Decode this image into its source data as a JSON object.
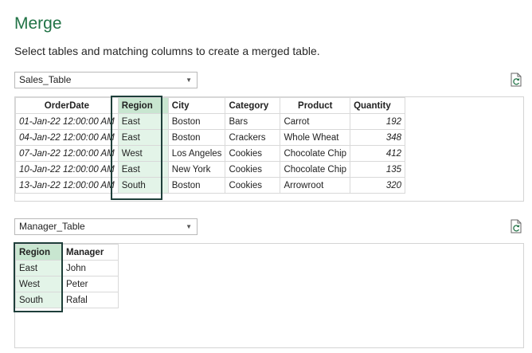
{
  "dialog": {
    "title": "Merge",
    "subtitle": "Select tables and matching columns to create a merged table."
  },
  "table1": {
    "selected": "Sales_Table",
    "columns": [
      "OrderDate",
      "Region",
      "City",
      "Category",
      "Product",
      "Quantity"
    ],
    "rows": [
      [
        "01-Jan-22 12:00:00 AM",
        "East",
        "Boston",
        "Bars",
        "Carrot",
        "192"
      ],
      [
        "04-Jan-22 12:00:00 AM",
        "East",
        "Boston",
        "Crackers",
        "Whole Wheat",
        "348"
      ],
      [
        "07-Jan-22 12:00:00 AM",
        "West",
        "Los Angeles",
        "Cookies",
        "Chocolate Chip",
        "412"
      ],
      [
        "10-Jan-22 12:00:00 AM",
        "East",
        "New York",
        "Cookies",
        "Chocolate Chip",
        "135"
      ],
      [
        "13-Jan-22 12:00:00 AM",
        "South",
        "Boston",
        "Cookies",
        "Arrowroot",
        "320"
      ]
    ],
    "selected_column": "Region"
  },
  "table2": {
    "selected": "Manager_Table",
    "columns": [
      "Region",
      "Manager"
    ],
    "rows": [
      [
        "East",
        "John"
      ],
      [
        "West",
        "Peter"
      ],
      [
        "South",
        "Rafal"
      ]
    ],
    "selected_column": "Region"
  },
  "icons": {
    "dropdown": "chevron-down-icon",
    "refresh": "refresh-preview-icon"
  },
  "colors": {
    "title": "#217346",
    "selected_column_fill": "#e3f4e8",
    "selected_header_fill": "#c8e6d0",
    "selection_border": "#1e3f3a"
  }
}
